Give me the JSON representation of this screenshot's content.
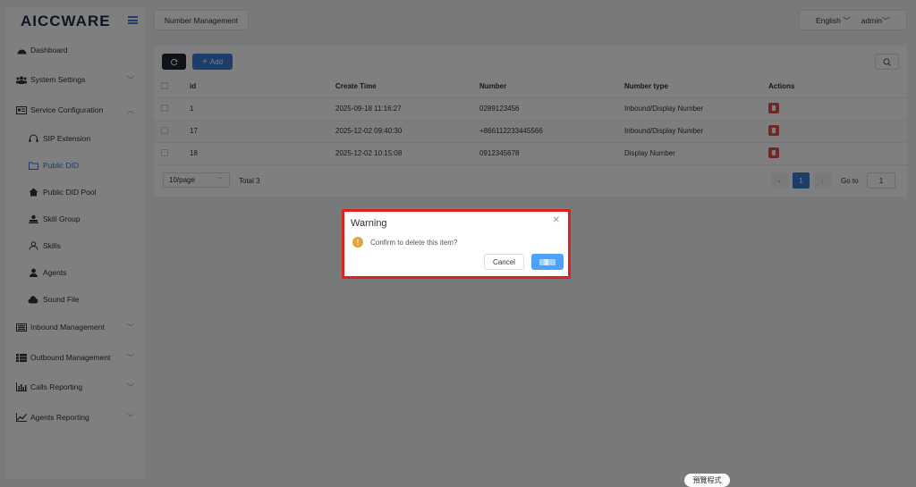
{
  "sidebar": {
    "logo": "AICCWARE",
    "items": [
      {
        "label": "Dashboard",
        "icon": "dashboard-icon"
      },
      {
        "label": "System Settings",
        "icon": "users-icon"
      },
      {
        "label": "Service Configuration",
        "icon": "card-icon"
      },
      {
        "label": "Inbound Management",
        "icon": "list-icon"
      },
      {
        "label": "Outbound Management",
        "icon": "grid-list-icon"
      },
      {
        "label": "Calls Reporting",
        "icon": "bar-chart-icon"
      },
      {
        "label": "Agents Reporting",
        "icon": "line-chart-icon"
      }
    ],
    "sub_items": [
      {
        "label": "SIP Extension",
        "icon": "headset-icon"
      },
      {
        "label": "Public DID",
        "icon": "folder-icon"
      },
      {
        "label": "Public DID Pool",
        "icon": "home-icon"
      },
      {
        "label": "Skill Group",
        "icon": "user-group-icon"
      },
      {
        "label": "Skills",
        "icon": "user-outline-icon"
      },
      {
        "label": "Agents",
        "icon": "user-icon"
      },
      {
        "label": "Sound File",
        "icon": "cloud-icon"
      }
    ]
  },
  "header": {
    "tab": "Number Management",
    "language": "English",
    "user": "admin"
  },
  "toolbar": {
    "add_label": "Add"
  },
  "table": {
    "columns": [
      "id",
      "Create Time",
      "Number",
      "Number type",
      "Actions"
    ],
    "rows": [
      {
        "id": "1",
        "create_time": "2025-09-18 11:16:27",
        "number": "0289123456",
        "number_type": "Inbound/Display Number"
      },
      {
        "id": "17",
        "create_time": "2025-12-02 09:40:30",
        "number": "+866112233445566",
        "number_type": "Inbound/Display Number"
      },
      {
        "id": "18",
        "create_time": "2025-12-02 10:15:08",
        "number": "0912345678",
        "number_type": "Display Number"
      }
    ]
  },
  "pagination": {
    "page_size": "10/page",
    "total": "Total 3",
    "current_page": "1",
    "goto_label": "Go to",
    "goto_value": "1"
  },
  "dialog": {
    "title": "Warning",
    "message": "Confirm to delete this item?",
    "cancel_label": "Cancel"
  },
  "taskbar_pill": "預覽程式",
  "colors": {
    "primary": "#3a7bd5",
    "danger": "#e05252",
    "warning": "#e6a23c",
    "highlight_border": "#e01f1f"
  }
}
